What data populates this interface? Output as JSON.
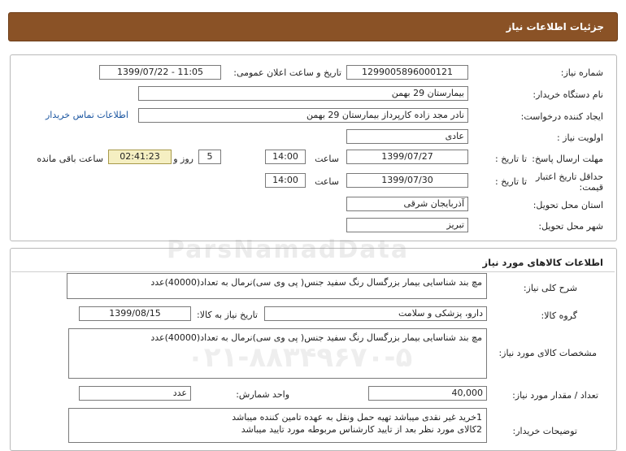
{
  "header": {
    "title": "جزئیات اطلاعات نیاز"
  },
  "details": {
    "need_number_label": "شماره نیاز:",
    "need_number": "1299005896000121",
    "announce_label": "تاریخ و ساعت اعلان عمومی:",
    "announce_value": "1399/07/22 - 11:05",
    "buyer_org_label": "نام دستگاه خریدار:",
    "buyer_org": "بیمارستان 29 بهمن",
    "requester_label": "ایجاد کننده درخواست:",
    "requester": "نادر مجد زاده کارپرداز بیمارستان 29 بهمن",
    "contact_link": "اطلاعات تماس خریدار",
    "priority_label": "اولویت نیاز :",
    "priority": "عادی",
    "deadline_label": "مهلت ارسال پاسخ:",
    "until_date_label": "تا تاریخ :",
    "deadline_date": "1399/07/27",
    "time_label": "ساعت",
    "deadline_time": "14:00",
    "days_count": "5",
    "days_label": "روز و",
    "remaining_time": "02:41:23",
    "remaining_label": "ساعت باقی مانده",
    "validity_label": "حداقل تاریخ اعتبار قیمت:",
    "validity_date": "1399/07/30",
    "validity_time": "14:00",
    "province_label": "استان محل تحویل:",
    "province": "آذربایجان شرقی",
    "city_label": "شهر محل تحویل:",
    "city": "تبریز"
  },
  "goods": {
    "section_title": "اطلاعات کالاهای مورد نیاز",
    "summary_label": "شرح کلی نیاز:",
    "summary": "مچ بند شناسایی بیمار بزرگسال رنگ سفید جنس( پی وی سی)نرمال به تعداد(40000)عدد",
    "group_label": "گروه کالا:",
    "group": "دارو، پزشکی و سلامت",
    "need_date_label": "تاریخ نیاز به کالا:",
    "need_date": "1399/08/15",
    "spec_label": "مشخصات کالای مورد نیاز:",
    "spec": "مچ بند شناسایی بیمار بزرگسال رنگ سفید جنس( پی وی سی)نرمال به تعداد(40000)عدد",
    "qty_label": "تعداد / مقدار مورد نیاز:",
    "qty": "40,000",
    "unit_label": "واحد شمارش:",
    "unit": "عدد",
    "buyer_notes_label": "توضیحات خریدار:",
    "buyer_notes_line1": "1خرید غیر نقدی میباشد تهیه حمل ونقل به عهده تامین کننده میباشد",
    "buyer_notes_line2": "2کالای مورد نظر بعد از تایید کارشناس مربوطه مورد تایید میباشد"
  },
  "watermark": {
    "text1": "ParsNamadData",
    "text2": "۰۲۱-۸۸۳۴۹۶۷۰-۵"
  }
}
